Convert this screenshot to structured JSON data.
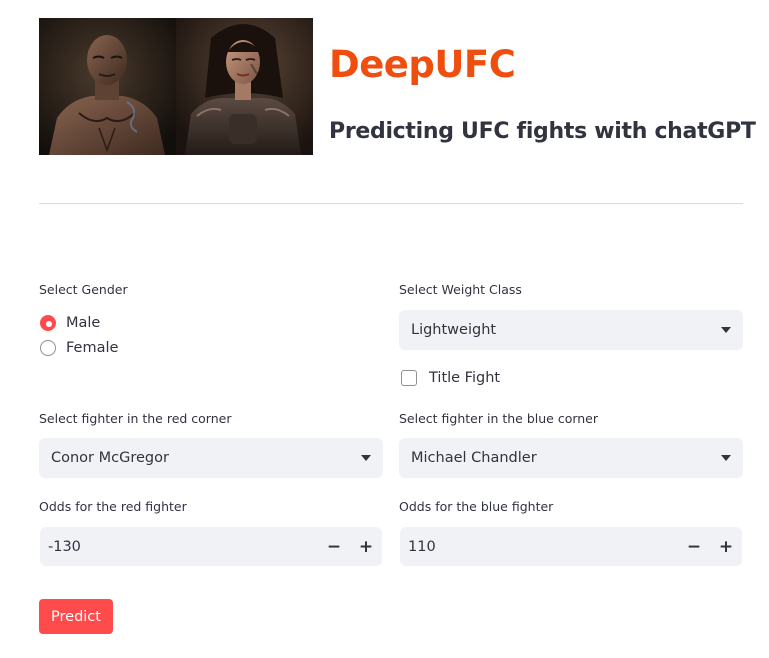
{
  "header": {
    "title": "DeepUFC",
    "subtitle": "Predicting UFC fights with chatGPT",
    "image_alt": "Two AI-generated portraits of UFC fighters, a male and a female"
  },
  "gender": {
    "label": "Select Gender",
    "options": [
      "Male",
      "Female"
    ],
    "selected": "Male"
  },
  "weight_class": {
    "label": "Select Weight Class",
    "value": "Lightweight"
  },
  "title_fight": {
    "label": "Title Fight",
    "checked": false
  },
  "red_corner": {
    "label": "Select fighter in the red corner",
    "value": "Conor McGregor"
  },
  "blue_corner": {
    "label": "Select fighter in the blue corner",
    "value": "Michael Chandler"
  },
  "red_odds": {
    "label": "Odds for the red fighter",
    "value": "-130",
    "minus": "−",
    "plus": "+"
  },
  "blue_odds": {
    "label": "Odds for the blue fighter",
    "value": "110",
    "minus": "−",
    "plus": "+"
  },
  "predict_button": {
    "label": "Predict"
  },
  "colors": {
    "title": "#EF4E0F",
    "accent": "#FF4B4B",
    "input_bg": "#F0F2F6",
    "text": "#31333F"
  },
  "icons": {
    "select_caret": "chevron-down-icon",
    "minus": "minus-icon",
    "plus": "plus-icon"
  }
}
